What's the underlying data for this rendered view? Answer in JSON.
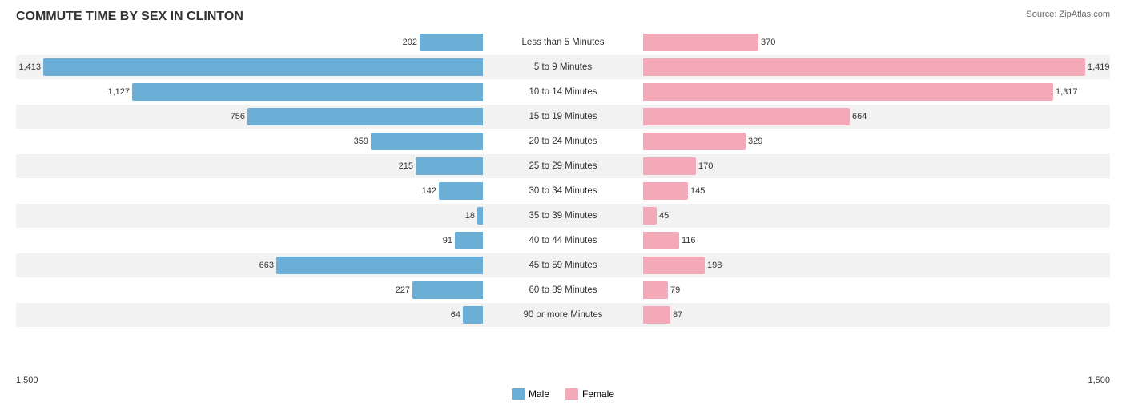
{
  "title": "COMMUTE TIME BY SEX IN CLINTON",
  "source": "Source: ZipAtlas.com",
  "maxVal": 1500,
  "halfWidth": 550,
  "centerLabelWidth": 200,
  "legend": {
    "male_label": "Male",
    "female_label": "Female",
    "male_color": "#6baed6",
    "female_color": "#f4a9b8"
  },
  "axis": {
    "left": "1,500",
    "right": "1,500"
  },
  "rows": [
    {
      "label": "Less than 5 Minutes",
      "male": 202,
      "female": 370,
      "alt": false
    },
    {
      "label": "5 to 9 Minutes",
      "male": 1413,
      "female": 1419,
      "alt": true
    },
    {
      "label": "10 to 14 Minutes",
      "male": 1127,
      "female": 1317,
      "alt": false
    },
    {
      "label": "15 to 19 Minutes",
      "male": 756,
      "female": 664,
      "alt": true
    },
    {
      "label": "20 to 24 Minutes",
      "male": 359,
      "female": 329,
      "alt": false
    },
    {
      "label": "25 to 29 Minutes",
      "male": 215,
      "female": 170,
      "alt": true
    },
    {
      "label": "30 to 34 Minutes",
      "male": 142,
      "female": 145,
      "alt": false
    },
    {
      "label": "35 to 39 Minutes",
      "male": 18,
      "female": 45,
      "alt": true
    },
    {
      "label": "40 to 44 Minutes",
      "male": 91,
      "female": 116,
      "alt": false
    },
    {
      "label": "45 to 59 Minutes",
      "male": 663,
      "female": 198,
      "alt": true
    },
    {
      "label": "60 to 89 Minutes",
      "male": 227,
      "female": 79,
      "alt": false
    },
    {
      "label": "90 or more Minutes",
      "male": 64,
      "female": 87,
      "alt": true
    }
  ]
}
